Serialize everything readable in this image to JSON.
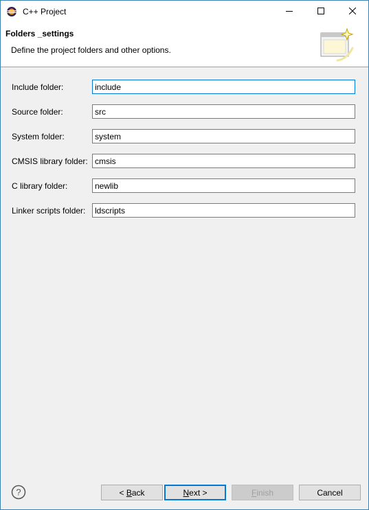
{
  "window": {
    "title": "C++ Project"
  },
  "banner": {
    "title": "Folders _settings",
    "description": "Define the project folders and other options."
  },
  "fields": [
    {
      "label": "Include folder:",
      "value": "include"
    },
    {
      "label": "Source folder:",
      "value": "src"
    },
    {
      "label": "System folder:",
      "value": "system"
    },
    {
      "label": "CMSIS library folder:",
      "value": "cmsis"
    },
    {
      "label": "C library folder:",
      "value": "newlib"
    },
    {
      "label": "Linker scripts folder:",
      "value": "ldscripts"
    }
  ],
  "buttons": {
    "back": {
      "mnemonic": "< ",
      "key": "B",
      "rest": "ack"
    },
    "next": {
      "key": "N",
      "rest": "ext >"
    },
    "finish": {
      "key": "F",
      "rest": "inish"
    },
    "cancel": "Cancel"
  },
  "colors": {
    "accent": "#0078d7",
    "window_border": "#3c7fb1",
    "panel_bg": "#f0f0f0"
  }
}
